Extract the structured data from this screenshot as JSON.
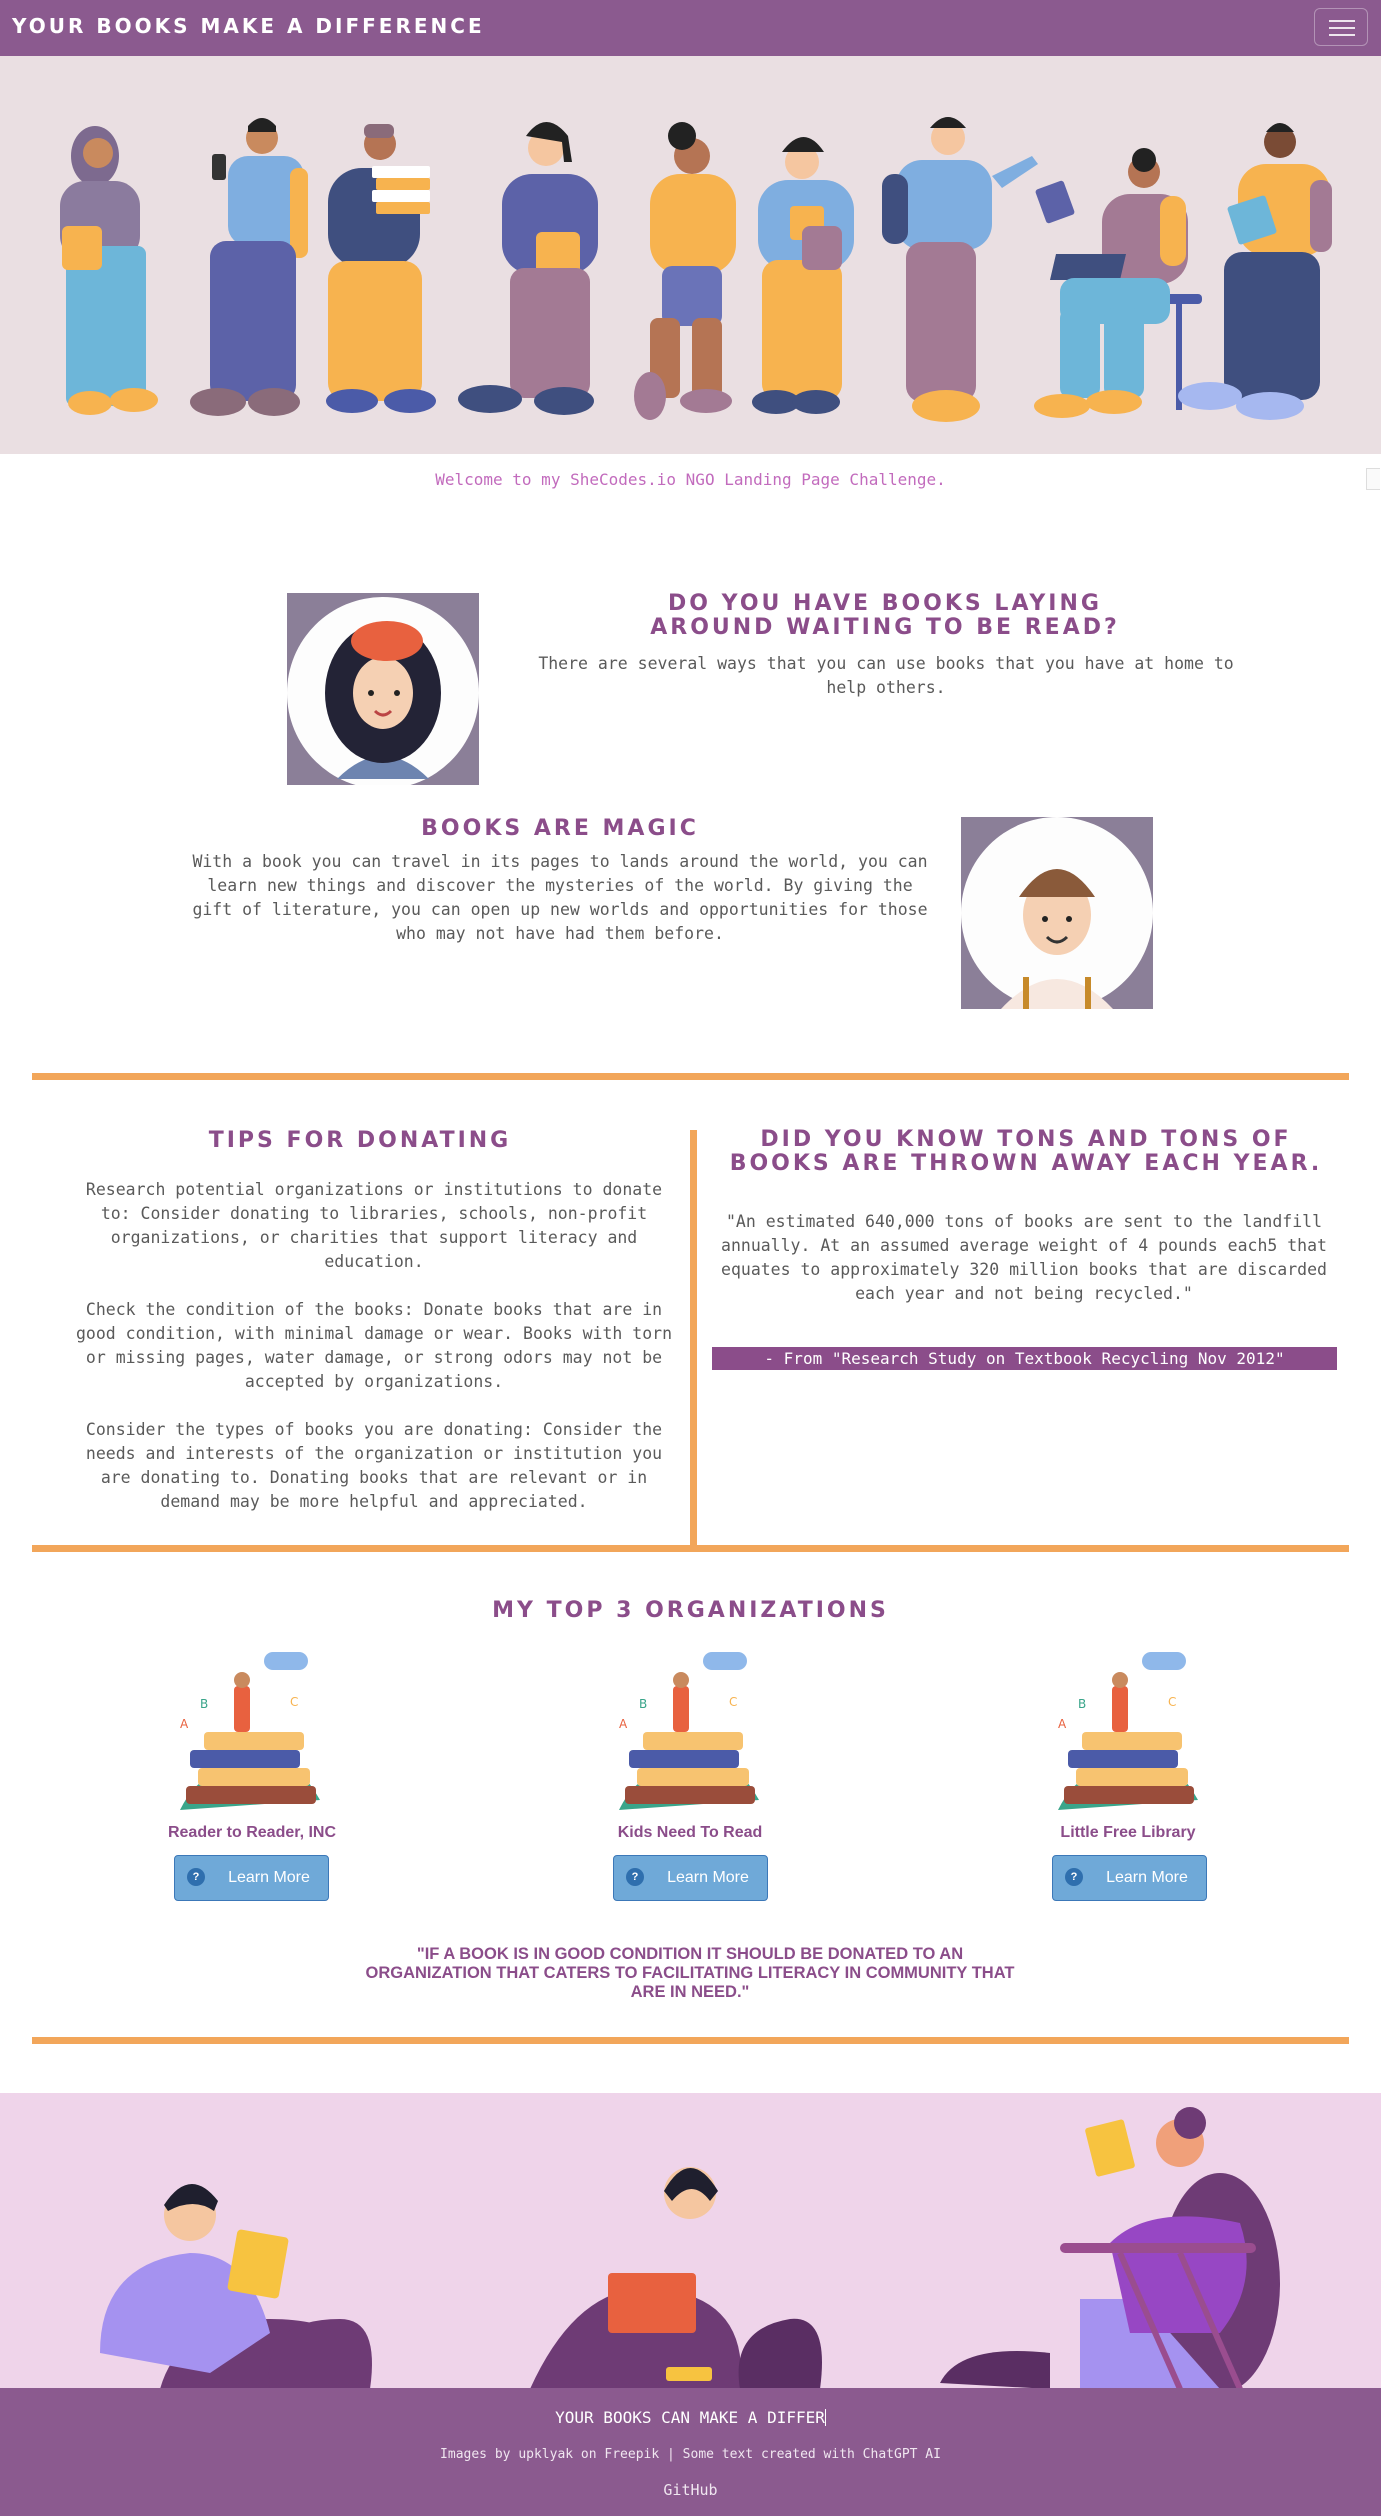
{
  "navbar": {
    "brand": "YOUR BOOKS MAKE A DIFFERENCE",
    "menu_icon": "hamburger-menu-icon"
  },
  "hero": {
    "illustration": "group of students holding books",
    "welcome": "Welcome to my SheCodes.io NGO Landing Page Challenge."
  },
  "section_books_laying": {
    "heading": "DO YOU HAVE BOOKS LAYING AROUND WAITING TO BE READ?",
    "text": "There are several ways that you can use books that you have at home to help others."
  },
  "section_magic": {
    "heading": "BOOKS ARE MAGIC",
    "text": "With a book you can travel in its pages to lands around the world, you can learn new things and discover the mysteries of the world. By giving the gift of literature, you can open up new worlds and opportunities for those who may not have had them before."
  },
  "tips": {
    "heading": "TIPS FOR DONATING",
    "items": [
      "Research potential organizations or institutions to donate to: Consider donating to libraries, schools, non-profit organizations, or charities that support literacy and education.",
      "Check the condition of the books: Donate books that are in good condition, with minimal damage or wear. Books with torn or missing pages, water damage, or strong odors may not be accepted by organizations.",
      "Consider the types of books you are donating: Consider the needs and interests of the organization or institution you are donating to. Donating books that are relevant or in demand may be more helpful and appreciated."
    ]
  },
  "fact": {
    "heading": "DID YOU KNOW TONS AND TONS OF BOOKS ARE THROWN AWAY EACH YEAR.",
    "quote": "\"An estimated 640,000 tons of books are sent to the landfill annually. At an assumed average weight of 4 pounds each5 that equates to approximately 320 million books that are discarded each year and not being recycled.\"",
    "source": "- From \"Research Study on Textbook Recycling Nov 2012\""
  },
  "orgs": {
    "heading": "MY TOP 3 ORGANIZATIONS",
    "items": [
      {
        "name": "Reader to Reader, INC",
        "button": "Learn More"
      },
      {
        "name": "Kids Need To Read",
        "button": "Learn More"
      },
      {
        "name": "Little Free Library",
        "button": "Learn More"
      }
    ],
    "button_icon": "question-circle-icon"
  },
  "closing_quote": "\"IF A BOOK IS IN GOOD CONDITION IT SHOULD BE DONATED TO AN ORGANIZATION THAT CATERS TO FACILITATING LITERACY IN COMMUNITY THAT ARE IN NEED.\"",
  "footer": {
    "title": "YOUR BOOKS CAN MAKE A DIFFER",
    "credits": "Images by upklyak on Freepik | Some text created with ChatGPT AI",
    "github": "GitHub"
  },
  "colors": {
    "primary": "#8b5a8f",
    "heading": "#8b4d8a",
    "accent": "#f2a65a",
    "button": "#6fa9d8",
    "hero_bg": "#eadfe2",
    "bottom_bg": "#efd4ea"
  }
}
